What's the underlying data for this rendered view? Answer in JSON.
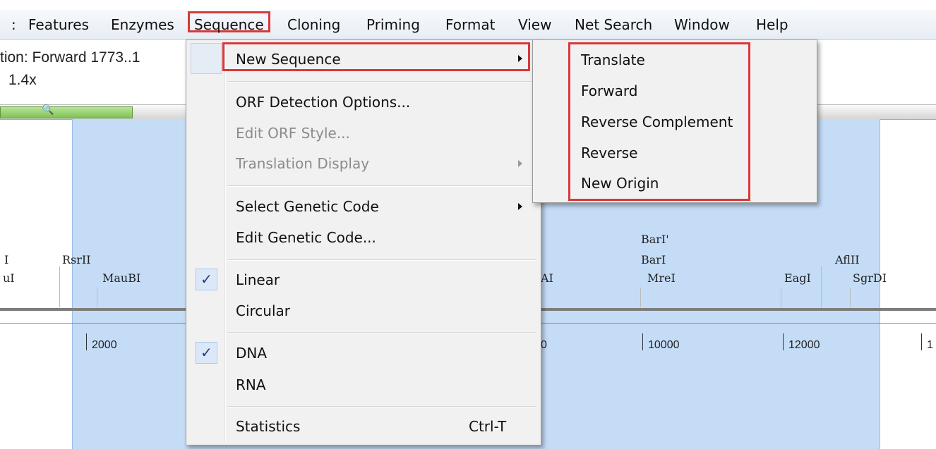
{
  "menubar": {
    "items": [
      {
        "label": ":",
        "key": "colon"
      },
      {
        "label": "Features",
        "key": "features"
      },
      {
        "label": "Enzymes",
        "key": "enzymes"
      },
      {
        "label": "Sequence",
        "key": "sequence"
      },
      {
        "label": "Cloning",
        "key": "cloning"
      },
      {
        "label": "Priming",
        "key": "priming"
      },
      {
        "label": "Format",
        "key": "format"
      },
      {
        "label": "View",
        "key": "view"
      },
      {
        "label": "Net Search",
        "key": "net-search"
      },
      {
        "label": "Window",
        "key": "window"
      },
      {
        "label": "Help",
        "key": "help"
      }
    ]
  },
  "info": {
    "selection": "tion: Forward  1773..1",
    "zoom": "1.4x"
  },
  "map": {
    "enzymes": [
      "I",
      "RsrII",
      "uI",
      "MauBI",
      "BarI'",
      "BarI",
      "AflII",
      "MreI",
      "EagI",
      "SgrDI",
      "AI"
    ],
    "ruler": [
      "2000",
      "10000",
      "12000",
      "0",
      "1"
    ]
  },
  "sequence_menu": {
    "new_sequence": "New Sequence",
    "orf_options": "ORF Detection Options...",
    "edit_orf_style": "Edit ORF Style...",
    "translation_display": "Translation Display",
    "select_genetic_code": "Select Genetic Code",
    "edit_genetic_code": "Edit Genetic Code...",
    "linear": "Linear",
    "circular": "Circular",
    "dna": "DNA",
    "rna": "RNA",
    "statistics": "Statistics",
    "statistics_shortcut": "Ctrl-T",
    "checkmark": "✓"
  },
  "new_sequence_submenu": {
    "items": [
      "Translate",
      "Forward",
      "Reverse Complement",
      "Reverse",
      "New Origin"
    ]
  },
  "colors": {
    "highlight_box": "#d9383a",
    "selection": "#c5dcf7",
    "menu_bg": "#f1f1f1"
  }
}
